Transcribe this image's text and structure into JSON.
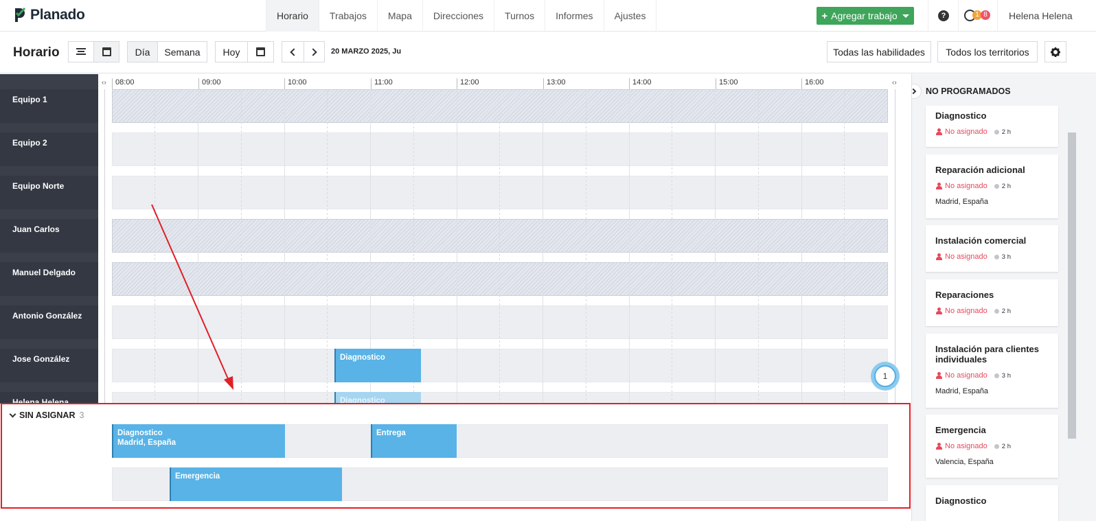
{
  "app": {
    "logo": "Planado"
  },
  "nav": {
    "tabs": [
      "Horario",
      "Trabajos",
      "Mapa",
      "Direcciones",
      "Turnos",
      "Informes",
      "Ajustes"
    ],
    "add_job": "Agregar trabajo",
    "help": "?",
    "badge_1": "1",
    "badge_2": "8",
    "user": "Helena Helena"
  },
  "toolbar": {
    "title": "Horario",
    "day": "Día",
    "week": "Semana",
    "today": "Hoy",
    "date": "20 MARZO 2025, Ju",
    "skills": "Todas las habilidades",
    "territories": "Todos los territorios"
  },
  "timeline": {
    "hours": [
      "08:00",
      "09:00",
      "10:00",
      "11:00",
      "12:00",
      "13:00",
      "14:00",
      "15:00",
      "16:00"
    ]
  },
  "teams": [
    "Equipo 1",
    "Equipo 2",
    "Equipo Norte",
    "Juan Carlos",
    "Manuel Delgado",
    "Antonio González",
    "Jose González",
    "Helena Helena"
  ],
  "jobs": {
    "jose": "Diagnostico",
    "helena": "Diagnostico"
  },
  "bubble": "1",
  "unassigned": {
    "title": "SIN ASIGNAR",
    "count": "3",
    "jobs": [
      {
        "title": "Diagnostico",
        "address": "Madrid, España"
      },
      {
        "title": "Entrega",
        "address": ""
      },
      {
        "title": "Emergencia",
        "address": ""
      }
    ]
  },
  "panel": {
    "title": "NO PROGRAMADOS",
    "unassigned_label": "No asignado",
    "cards": [
      {
        "title": "Diagnostico",
        "duration": "2 h",
        "address": ""
      },
      {
        "title": "Reparación adicional",
        "duration": "2 h",
        "address": "Madrid, España"
      },
      {
        "title": "Instalación comercial",
        "duration": "3 h",
        "address": ""
      },
      {
        "title": "Reparaciones",
        "duration": "2 h",
        "address": ""
      },
      {
        "title": "Instalación para clientes individuales",
        "duration": "3 h",
        "address": "Madrid, España"
      },
      {
        "title": "Emergencia",
        "duration": "2 h",
        "address": "Valencia, España"
      },
      {
        "title": "Diagnostico",
        "duration": "",
        "address": ""
      }
    ]
  },
  "colors": {
    "accent": "#3ea55b",
    "job": "#59b3e6",
    "highlight": "#e01f26",
    "danger": "#e8485c"
  }
}
